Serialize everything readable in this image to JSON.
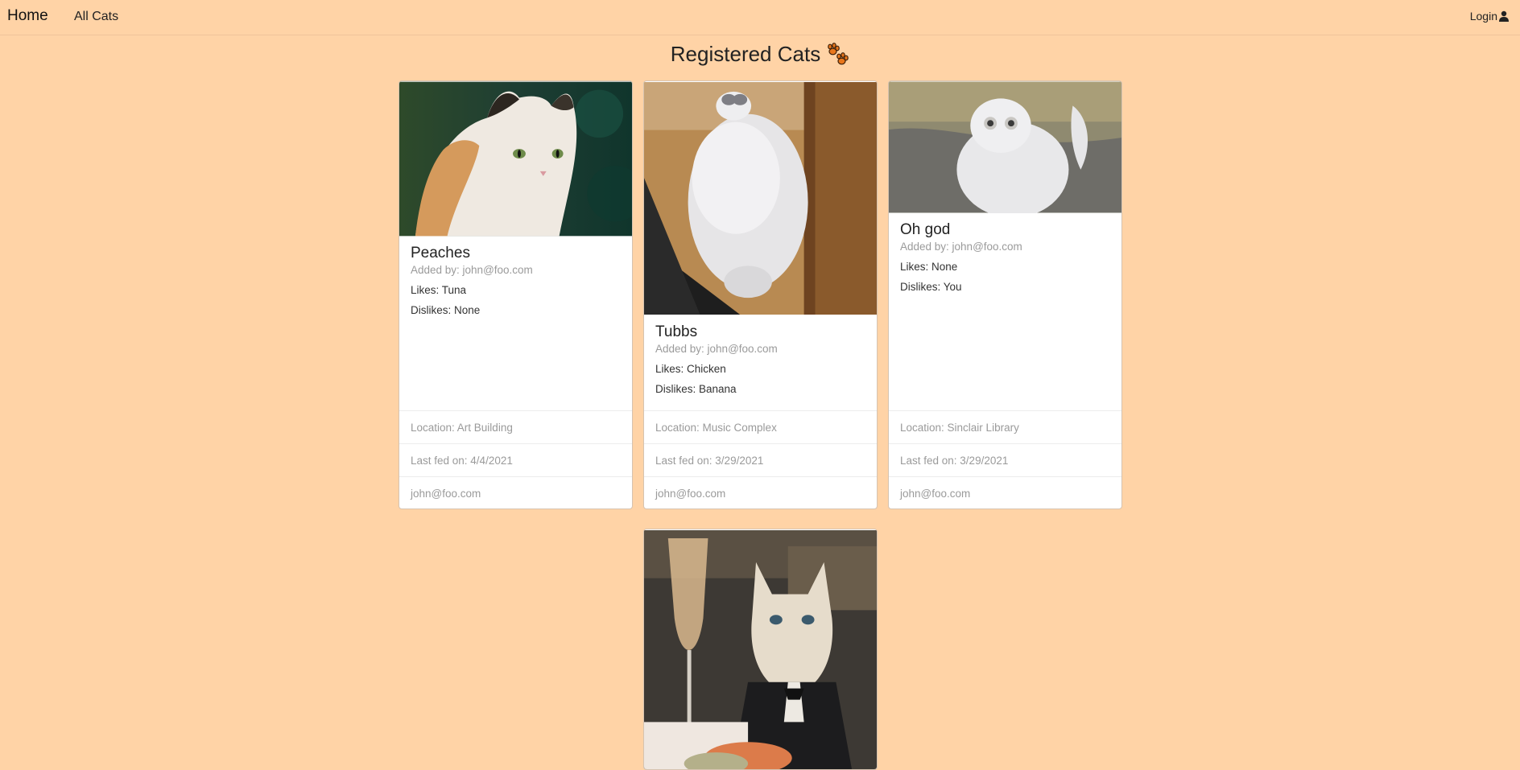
{
  "nav": {
    "brand": "Home",
    "all_cats": "All Cats",
    "login": "Login"
  },
  "page": {
    "title": "Registered Cats"
  },
  "cats": [
    {
      "name": "Peaches",
      "added_by": "Added by: john@foo.com",
      "likes": "Likes: Tuna",
      "dislikes": "Dislikes: None",
      "location": "Location: Art Building",
      "last_fed": "Last fed on: 4/4/2021",
      "owner": "john@foo.com"
    },
    {
      "name": "Tubbs",
      "added_by": "Added by: john@foo.com",
      "likes": "Likes: Chicken",
      "dislikes": "Dislikes: Banana",
      "location": "Location: Music Complex",
      "last_fed": "Last fed on: 3/29/2021",
      "owner": "john@foo.com"
    },
    {
      "name": "Oh god",
      "added_by": "Added by: john@foo.com",
      "likes": "Likes: None",
      "dislikes": "Dislikes: You",
      "location": "Location: Sinclair Library",
      "last_fed": "Last fed on: 3/29/2021",
      "owner": "john@foo.com"
    }
  ],
  "icons": {
    "title_icon": "paw-icon",
    "login_icon": "user-icon"
  },
  "colors": {
    "background": "#FFD3A6",
    "paw": "#E8761B"
  }
}
